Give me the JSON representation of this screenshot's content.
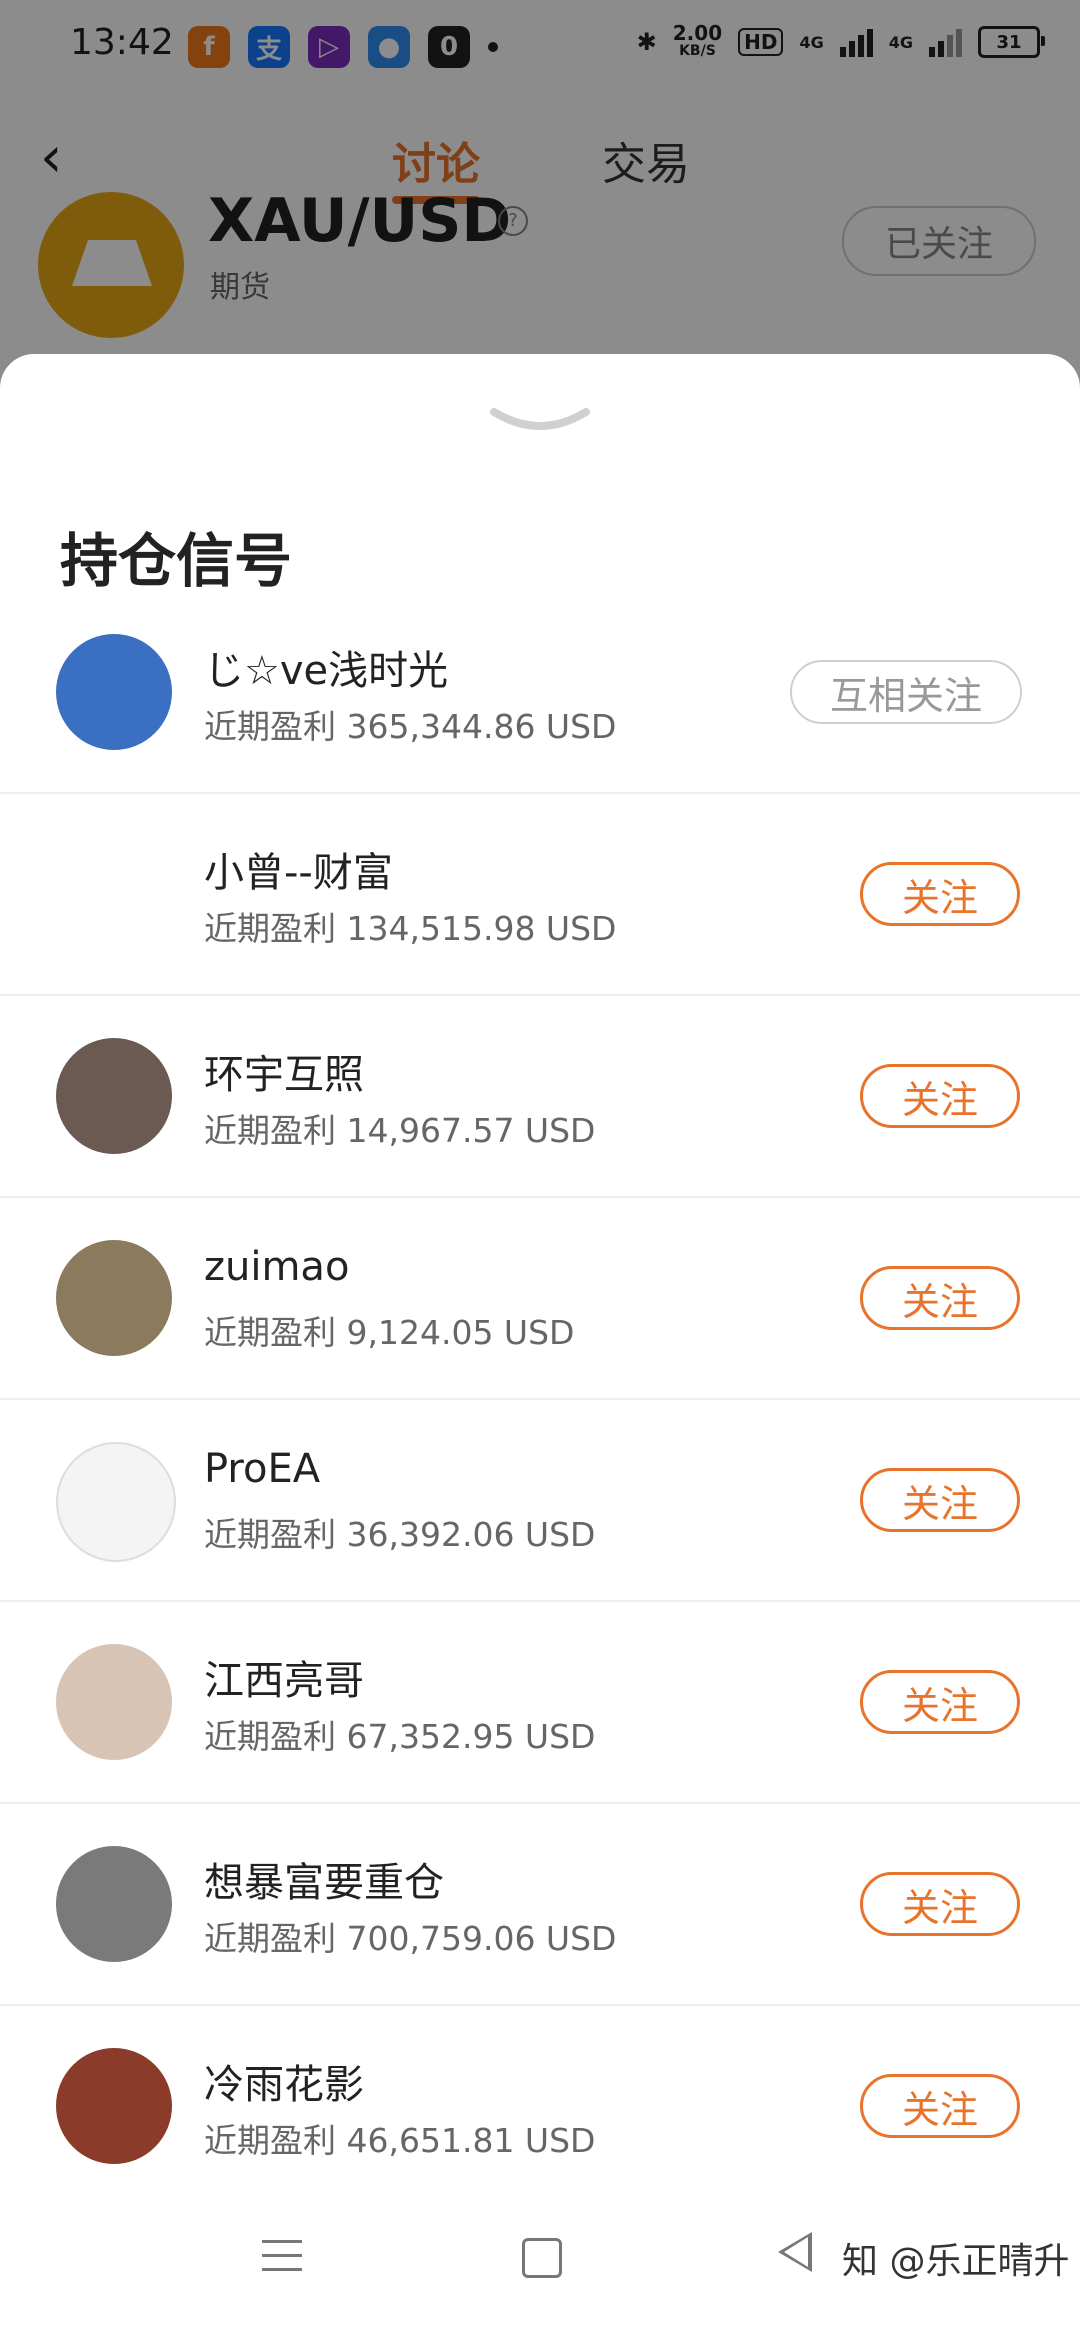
{
  "status_bar": {
    "time": "13:42",
    "apps": [
      {
        "icon": "orange-app-icon",
        "glyph": "f",
        "color": "#f07a1a"
      },
      {
        "icon": "alipay-icon",
        "glyph": "支",
        "color": "#1677ff"
      },
      {
        "icon": "video-app-icon",
        "glyph": "▷",
        "color": "#7b2cbf"
      },
      {
        "icon": "browser-app-icon",
        "glyph": "●",
        "color": "#2f8ff0"
      },
      {
        "icon": "square-app-icon",
        "glyph": "0",
        "color": "#222222"
      }
    ],
    "net_speed_value": "2.00",
    "net_speed_unit": "KB/S",
    "hd_label": "HD",
    "network_1": "4G",
    "network_2": "4G",
    "battery": "31"
  },
  "header": {
    "tabs": [
      {
        "label": "讨论",
        "active": true
      },
      {
        "label": "交易",
        "active": false
      }
    ],
    "symbol": "XAU/USD",
    "symbol_help": "?",
    "subtitle": "期货",
    "followed_label": "已关注"
  },
  "sheet": {
    "title": "持仓信号",
    "rows": [
      {
        "name": "じ☆ve浅时光",
        "profit": "近期盈利 365,344.86 USD",
        "button": "互相关注",
        "mutual": true,
        "avatar_color": "#3b6fc1"
      },
      {
        "name": "小曾--财富",
        "profit": "近期盈利 134,515.98 USD",
        "button": "关注",
        "mutual": false,
        "avatar_color": "#ffffff"
      },
      {
        "name": "环宇互照",
        "profit": "近期盈利 14,967.57 USD",
        "button": "关注",
        "mutual": false,
        "avatar_color": "#6b5a52"
      },
      {
        "name": "zuimao",
        "profit": "近期盈利 9,124.05 USD",
        "button": "关注",
        "mutual": false,
        "avatar_color": "#8c7a5e"
      },
      {
        "name": "ProEA",
        "profit": "近期盈利 36,392.06 USD",
        "button": "关注",
        "mutual": false,
        "avatar_color": "#f4f4f4"
      },
      {
        "name": "江西亮哥",
        "profit": "近期盈利 67,352.95 USD",
        "button": "关注",
        "mutual": false,
        "avatar_color": "#d8c4b4"
      },
      {
        "name": "想暴富要重仓",
        "profit": "近期盈利 700,759.06 USD",
        "button": "关注",
        "mutual": false,
        "avatar_color": "#7a7a7a"
      },
      {
        "name": "冷雨花影",
        "profit": "近期盈利 46,651.81 USD",
        "button": "关注",
        "mutual": false,
        "avatar_color": "#8a3b2a"
      }
    ]
  },
  "navbar": {
    "watermark": "知 @乐正晴升"
  },
  "colors": {
    "accent": "#e8742c",
    "gold": "#e6a817"
  }
}
